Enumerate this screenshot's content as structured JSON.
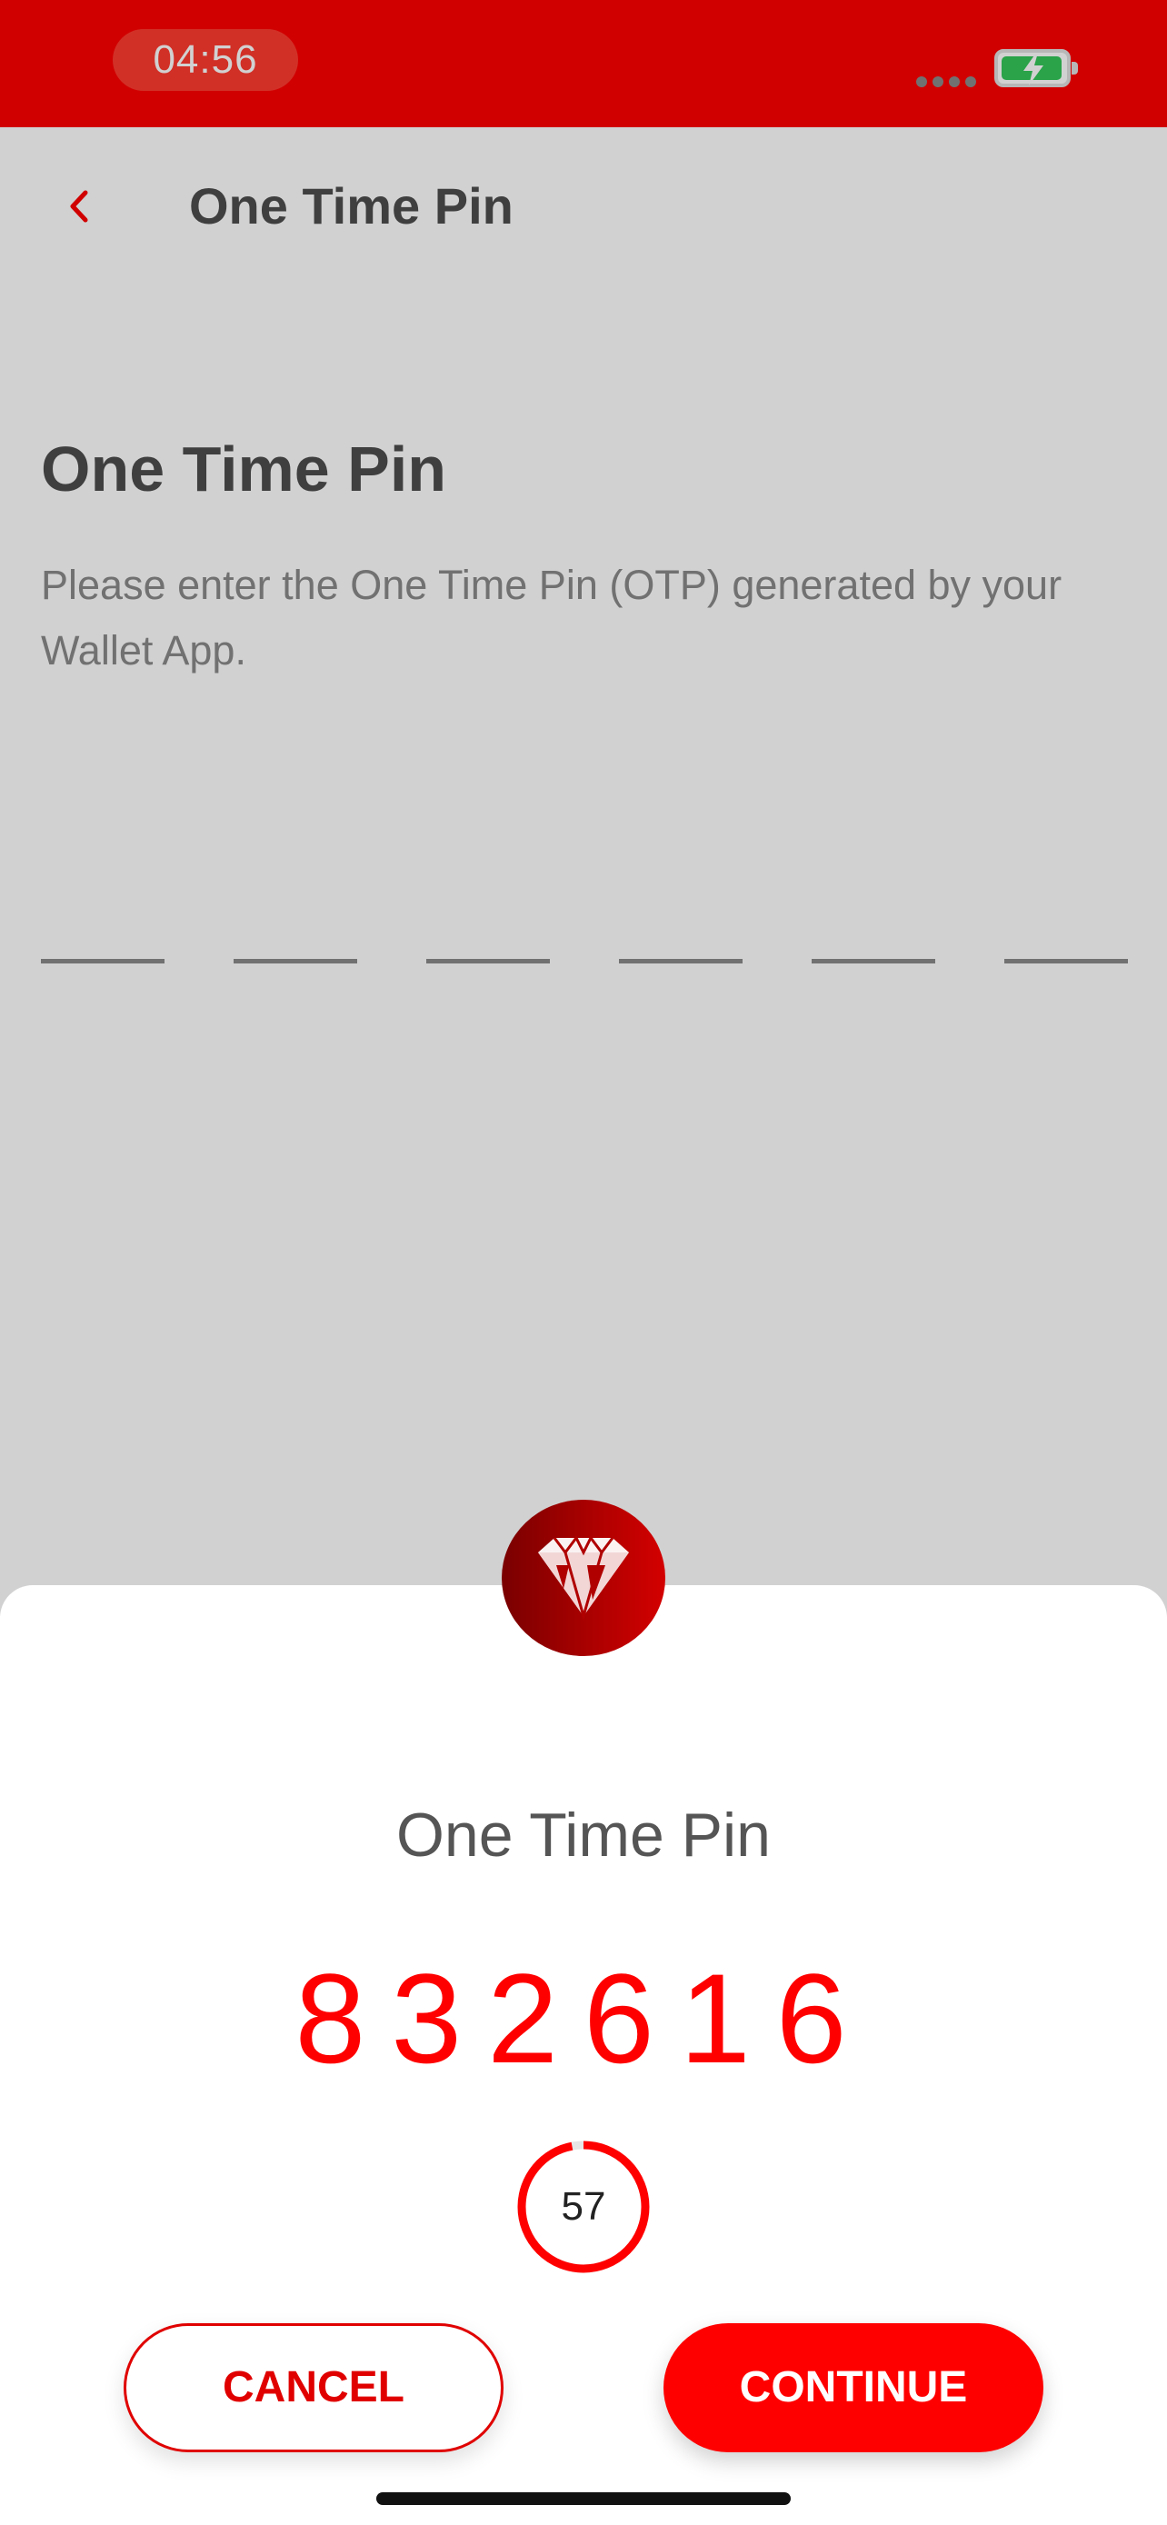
{
  "status_bar": {
    "time": "04:56",
    "icons": [
      "signal-dots-icon",
      "battery-charging-icon"
    ]
  },
  "header": {
    "back_icon": "chevron-left-icon",
    "title": "One Time Pin"
  },
  "main": {
    "heading": "One Time Pin",
    "description": "Please enter the One Time Pin (OTP) generated by your Wallet App.",
    "pin_slot_count": 6
  },
  "sheet": {
    "logo_icon": "diamond-logo-icon",
    "title": "One Time Pin",
    "otp_code": "832616",
    "timer_value": "57",
    "timer_progress": 0.97,
    "cancel_label": "CANCEL",
    "continue_label": "CONTINUE"
  },
  "colors": {
    "brand_red": "#ff0000",
    "time_pill": "#ff3b30",
    "battery_green": "#34c759"
  }
}
